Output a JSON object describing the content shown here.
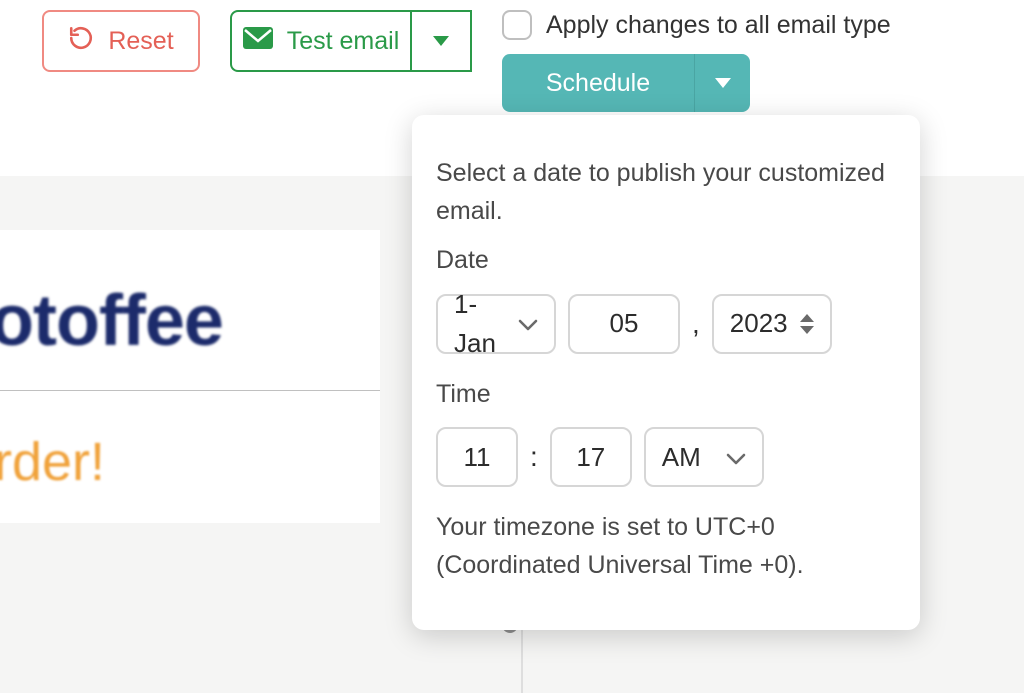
{
  "toolbar": {
    "reset_label": "Reset",
    "test_email_label": "Test email",
    "schedule_label": "Schedule",
    "apply_all_label": "Apply changes to all email type"
  },
  "popover": {
    "intro": "Select a date to publish your customized email.",
    "date_label": "Date",
    "time_label": "Time",
    "month": "1-Jan",
    "day": "05",
    "year": "2023",
    "hour": "11",
    "minute": "17",
    "ampm": "AM",
    "timezone": "Your timezone is set to UTC+0 (Coordinated Universal Time +0)."
  },
  "preview": {
    "brand_fragment": "otoffee",
    "headline_fragment": "rder!"
  },
  "icons": {
    "reset": "reset-icon",
    "mail": "mail-icon",
    "chevron_down": "chevron-down-icon",
    "triangle_down": "triangle-down-icon"
  }
}
